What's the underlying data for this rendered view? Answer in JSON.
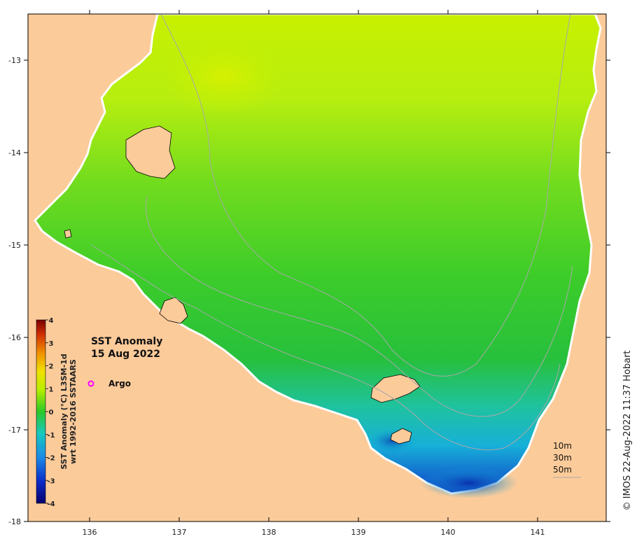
{
  "map": {
    "title_line1": "SST Anomaly",
    "title_line2": "15 Aug 2022",
    "legend_argo": "Argo",
    "copyright": "© IMOS 22-Aug-2022 11:37 Hobart",
    "x_ticks": [
      "136",
      "137",
      "138",
      "139",
      "140",
      "141"
    ],
    "y_ticks": [
      "-13",
      "-14",
      "-15",
      "-16",
      "-17",
      "-18"
    ],
    "depth_labels": [
      "10m",
      "30m",
      "50m"
    ],
    "colorbar": {
      "title_line1": "SST Anomaly (°C) L3SM-1d",
      "title_line2": "wrt 1992-2016 SSTAARS",
      "ticks": [
        "4",
        "3",
        "2",
        "1",
        "0",
        "-1",
        "-2",
        "-3",
        "-4"
      ]
    },
    "colors": {
      "land": "#fccb9a",
      "argo_marker": "#ff00ff"
    }
  }
}
